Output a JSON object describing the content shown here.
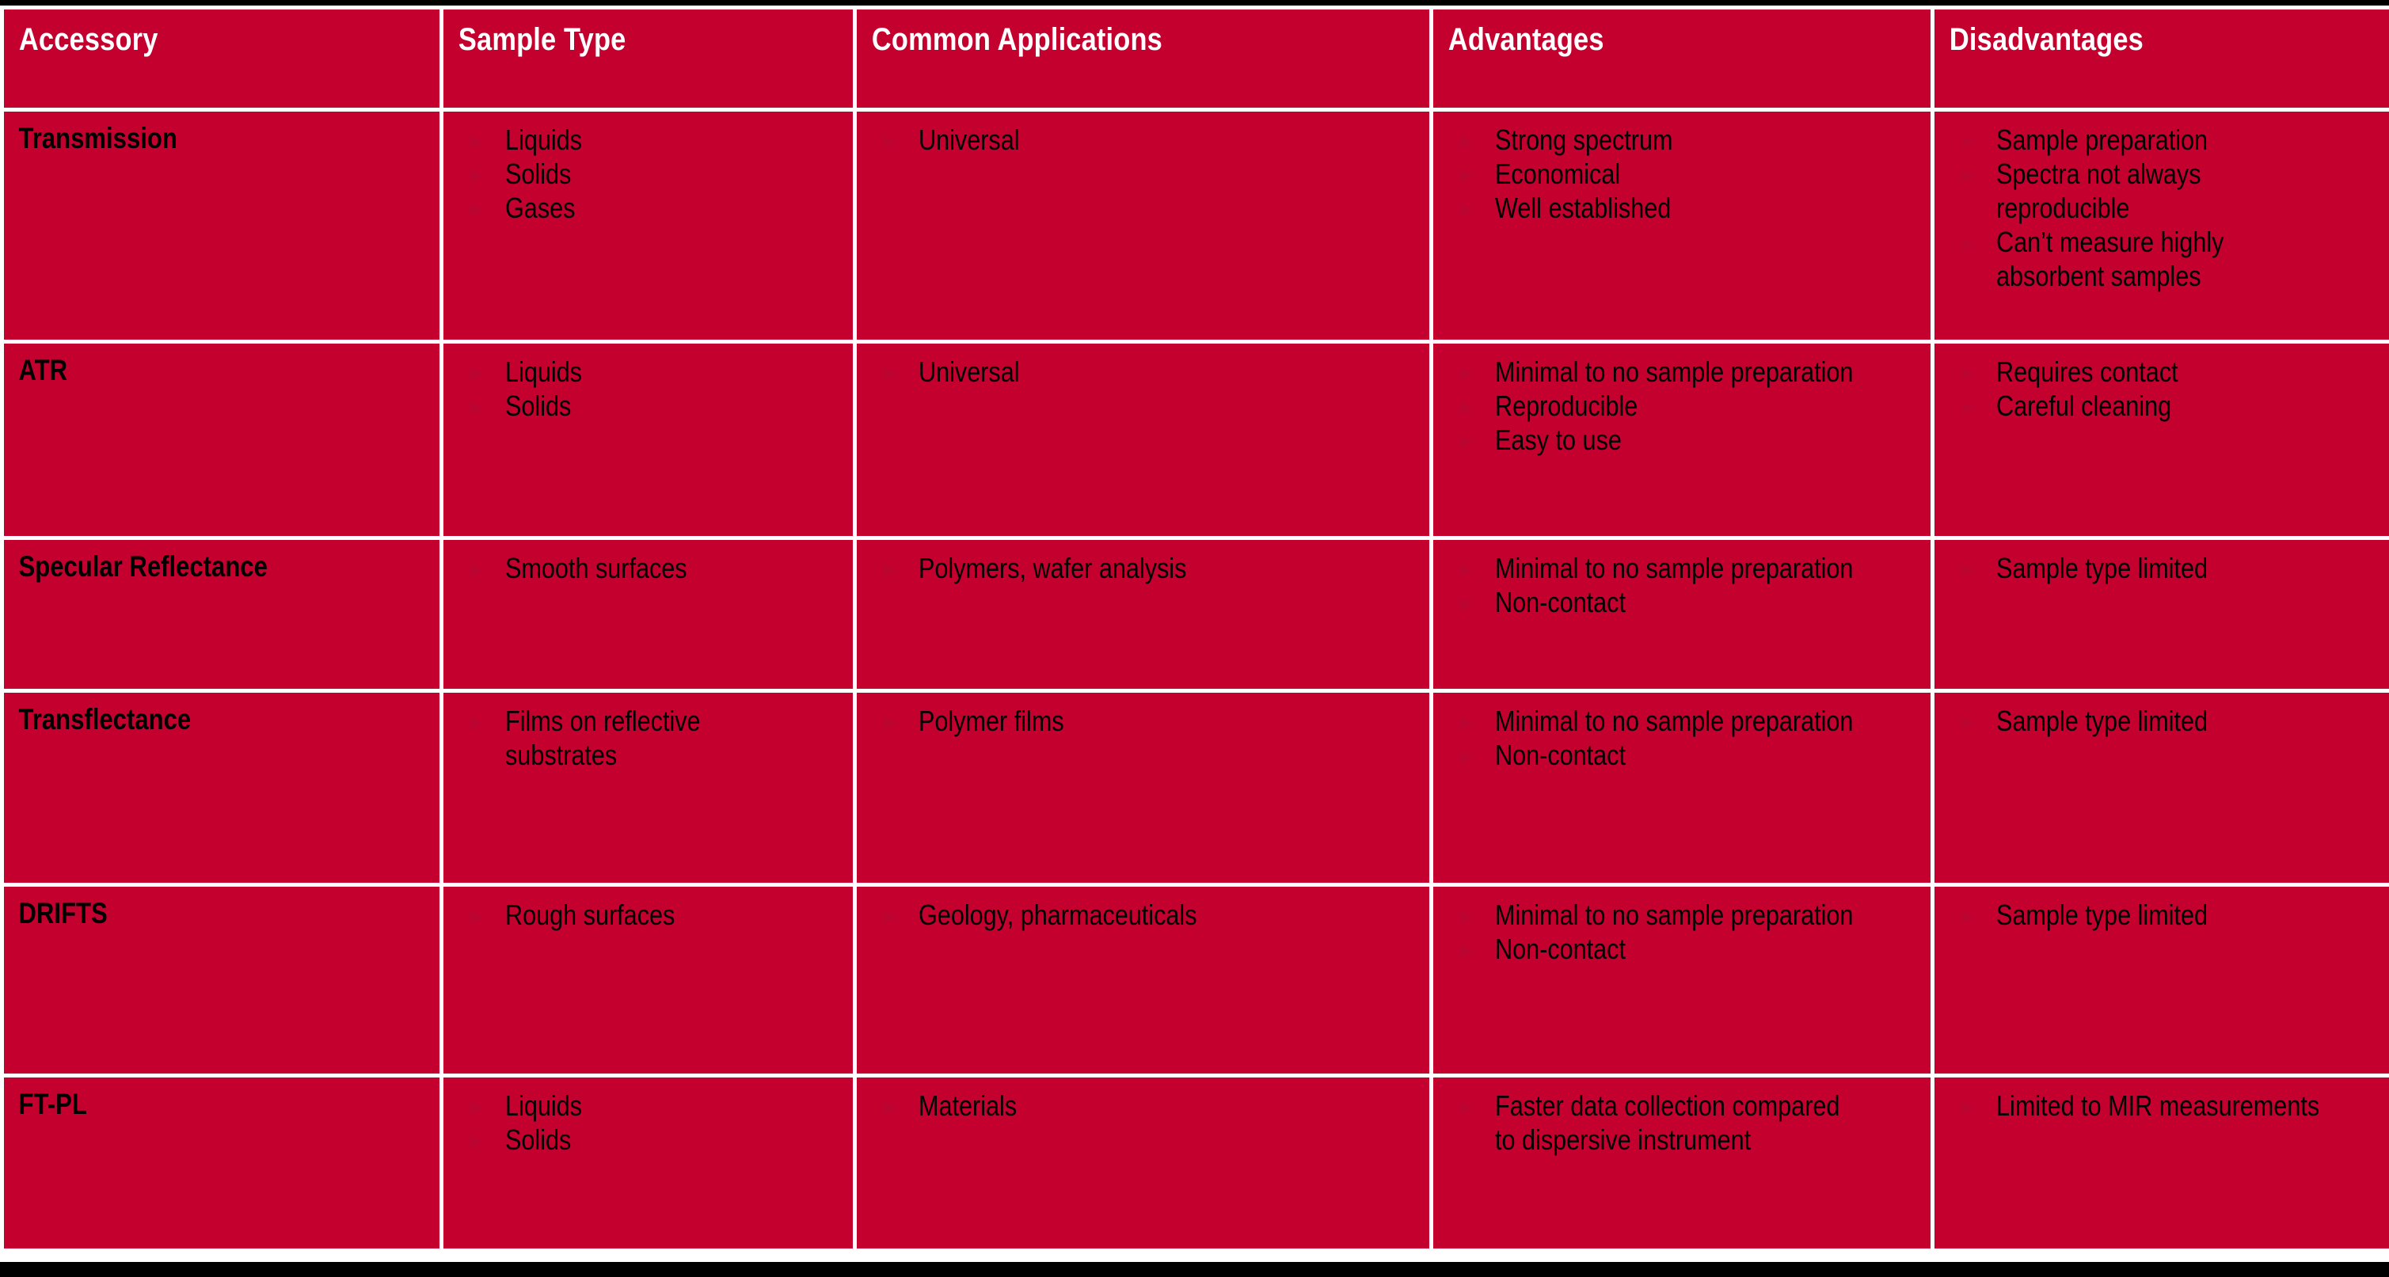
{
  "theme": {
    "cell_background": "#C4002F",
    "gutter_color": "#FFFFFF",
    "header_text_color": "#FFFFFF",
    "body_text_color": "#000000",
    "frame_color": "#000000",
    "bullet_marker_color": "#BC0430"
  },
  "table": {
    "columns": [
      {
        "key": "accessory",
        "label": "Accessory"
      },
      {
        "key": "sample_type",
        "label": "Sample Type"
      },
      {
        "key": "applications",
        "label": "Common Applications"
      },
      {
        "key": "advantages",
        "label": "Advantages"
      },
      {
        "key": "disadvantages",
        "label": "Disadvantages"
      }
    ],
    "rows": [
      {
        "accessory": "Transmission",
        "sample_type": [
          "Liquids",
          "Solids",
          "Gases"
        ],
        "applications": [
          "Universal"
        ],
        "advantages": [
          "Strong spectrum",
          "Economical",
          "Well established"
        ],
        "disadvantages": [
          "Sample preparation",
          "Spectra not always reproducible",
          "Can’t measure highly absorbent samples"
        ]
      },
      {
        "accessory": "ATR",
        "sample_type": [
          "Liquids",
          "Solids"
        ],
        "applications": [
          "Universal"
        ],
        "advantages": [
          "Minimal to no sample preparation",
          "Reproducible",
          "Easy to use"
        ],
        "disadvantages": [
          "Requires contact",
          "Careful cleaning"
        ]
      },
      {
        "accessory": "Specular Reflectance",
        "sample_type": [
          "Smooth surfaces"
        ],
        "applications": [
          "Polymers, wafer analysis"
        ],
        "advantages": [
          "Minimal to no sample preparation",
          "Non-contact"
        ],
        "disadvantages": [
          "Sample type limited"
        ]
      },
      {
        "accessory": "Transflectance",
        "sample_type": [
          "Films on reflective substrates"
        ],
        "applications": [
          "Polymer films"
        ],
        "advantages": [
          "Minimal to no sample preparation",
          "Non-contact"
        ],
        "disadvantages": [
          "Sample type limited"
        ]
      },
      {
        "accessory": "DRIFTS",
        "sample_type": [
          "Rough surfaces"
        ],
        "applications": [
          "Geology, pharmaceuticals"
        ],
        "advantages": [
          "Minimal to no sample preparation",
          "Non-contact"
        ],
        "disadvantages": [
          "Sample type limited"
        ]
      },
      {
        "accessory": "FT-PL",
        "sample_type": [
          "Liquids",
          "Solids"
        ],
        "applications": [
          "Materials"
        ],
        "advantages": [
          "Faster data collection compared to dispersive instrument"
        ],
        "disadvantages": [
          "Limited to MIR measurements"
        ]
      }
    ]
  }
}
